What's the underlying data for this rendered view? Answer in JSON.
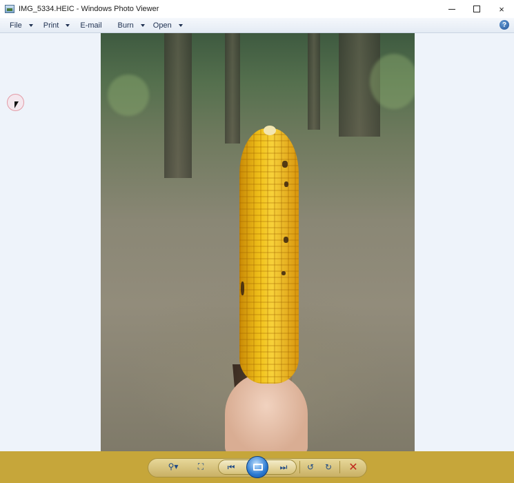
{
  "window": {
    "title": "IMG_5334.HEIC - Windows Photo Viewer",
    "controls": {
      "minimize": "minimize-icon",
      "maximize": "maximize-icon",
      "close": "×"
    }
  },
  "menu": {
    "items": [
      {
        "label": "File",
        "has_dropdown": true
      },
      {
        "label": "Print",
        "has_dropdown": true
      },
      {
        "label": "E-mail",
        "has_dropdown": false
      },
      {
        "label": "Burn",
        "has_dropdown": true
      },
      {
        "label": "Open",
        "has_dropdown": true
      }
    ],
    "help": "?"
  },
  "image": {
    "subject": "photo",
    "background_color": "#eef3fa"
  },
  "toolbar": {
    "background_color": "#c6a63a",
    "icons": {
      "zoom": "⚲▾",
      "fit": "⛶",
      "previous": "⏮",
      "next": "⏭",
      "rotate_ccw": "↺",
      "rotate_cw": "↻",
      "delete": "✕"
    }
  }
}
